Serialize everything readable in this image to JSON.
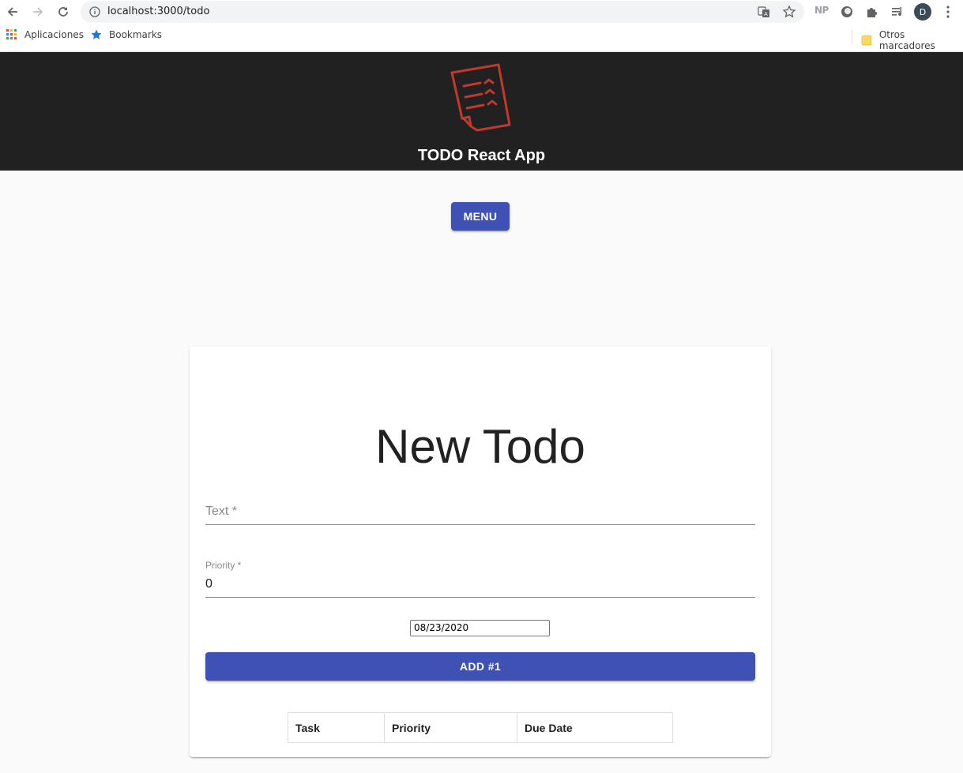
{
  "browser": {
    "url": "localhost:3000/todo",
    "extension_label": "NP",
    "avatar_initial": "D",
    "bookmarks": [
      {
        "label": "Aplicaciones",
        "icon": "apps-grid-icon"
      },
      {
        "label": "Bookmarks",
        "icon": "star-icon"
      }
    ],
    "other_bookmarks": {
      "label": "Otros marcadores",
      "icon": "folder-icon"
    }
  },
  "header": {
    "title": "TODO React App",
    "logo_icon": "todo-list-paper-icon",
    "background": "#212121",
    "logo_color": "#c0392b"
  },
  "menu": {
    "label": "MENU"
  },
  "form": {
    "title": "New Todo",
    "text_field": {
      "label": "Text *",
      "value": ""
    },
    "priority_field": {
      "label": "Priority *",
      "value": "0"
    },
    "date_value": "08/23/2020",
    "add_button": "ADD #1"
  },
  "table": {
    "columns": [
      "Task",
      "Priority",
      "Due Date"
    ],
    "rows": []
  },
  "colors": {
    "primary": "#3f51b5",
    "page_background": "#fafafa"
  }
}
